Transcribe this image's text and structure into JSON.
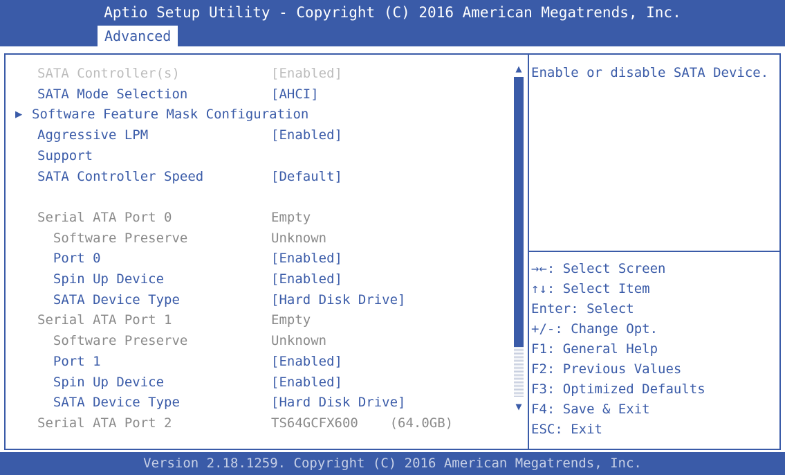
{
  "header": {
    "title": "Aptio Setup Utility - Copyright (C) 2016 American Megatrends, Inc.",
    "active_tab": "Advanced"
  },
  "settings": [
    {
      "label": "SATA Controller(s)",
      "value": "[Enabled]",
      "label_color": "light",
      "value_color": "light",
      "submenu": false
    },
    {
      "label": "SATA Mode Selection",
      "value": "[AHCI]",
      "label_color": "blue",
      "value_color": "blue",
      "submenu": false
    },
    {
      "label": "Software Feature Mask Configuration",
      "value": "",
      "label_color": "blue",
      "value_color": "blue",
      "submenu": true
    },
    {
      "label": "Aggressive LPM",
      "value": "[Enabled]",
      "label_color": "blue",
      "value_color": "blue",
      "submenu": false
    },
    {
      "label": "Support",
      "value": "",
      "label_color": "blue",
      "value_color": "blue",
      "submenu": false
    },
    {
      "label": "SATA Controller Speed",
      "value": "[Default]",
      "label_color": "blue",
      "value_color": "blue",
      "submenu": false
    },
    {
      "label": "",
      "value": "",
      "label_color": "gray",
      "value_color": "gray",
      "submenu": false
    },
    {
      "label": "Serial ATA Port 0",
      "value": "Empty",
      "label_color": "gray",
      "value_color": "gray",
      "submenu": false
    },
    {
      "label": "  Software Preserve",
      "value": "Unknown",
      "label_color": "gray",
      "value_color": "gray",
      "submenu": false
    },
    {
      "label": "  Port 0",
      "value": "[Enabled]",
      "label_color": "blue",
      "value_color": "blue",
      "submenu": false
    },
    {
      "label": "  Spin Up Device",
      "value": "[Enabled]",
      "label_color": "blue",
      "value_color": "blue",
      "submenu": false
    },
    {
      "label": "  SATA Device Type",
      "value": "[Hard Disk Drive]",
      "label_color": "blue",
      "value_color": "blue",
      "submenu": false
    },
    {
      "label": "Serial ATA Port 1",
      "value": "Empty",
      "label_color": "gray",
      "value_color": "gray",
      "submenu": false
    },
    {
      "label": "  Software Preserve",
      "value": "Unknown",
      "label_color": "gray",
      "value_color": "gray",
      "submenu": false
    },
    {
      "label": "  Port 1",
      "value": "[Enabled]",
      "label_color": "blue",
      "value_color": "blue",
      "submenu": false
    },
    {
      "label": "  Spin Up Device",
      "value": "[Enabled]",
      "label_color": "blue",
      "value_color": "blue",
      "submenu": false
    },
    {
      "label": "  SATA Device Type",
      "value": "[Hard Disk Drive]",
      "label_color": "blue",
      "value_color": "blue",
      "submenu": false
    },
    {
      "label": "Serial ATA Port 2",
      "value": "TS64GCFX600    (64.0GB)",
      "label_color": "gray",
      "value_color": "gray",
      "submenu": false
    }
  ],
  "help": {
    "description": "Enable or disable SATA Device."
  },
  "keys": [
    "→←: Select Screen",
    "↑↓: Select Item",
    "Enter: Select",
    "+/-: Change Opt.",
    "F1: General Help",
    "F2: Previous Values",
    "F3: Optimized Defaults",
    "F4: Save & Exit",
    "ESC: Exit"
  ],
  "footer": {
    "version": "Version 2.18.1259. Copyright (C) 2016 American Megatrends, Inc."
  },
  "colors": {
    "primary": "#3a5ba8",
    "background": "#ffffff",
    "inactive_text": "#8a8a8a",
    "selected_text": "#bcbcbc"
  },
  "icons": {
    "submenu": "triangle-right-icon",
    "scroll_up": "triangle-up-icon",
    "scroll_down": "triangle-down-icon"
  }
}
